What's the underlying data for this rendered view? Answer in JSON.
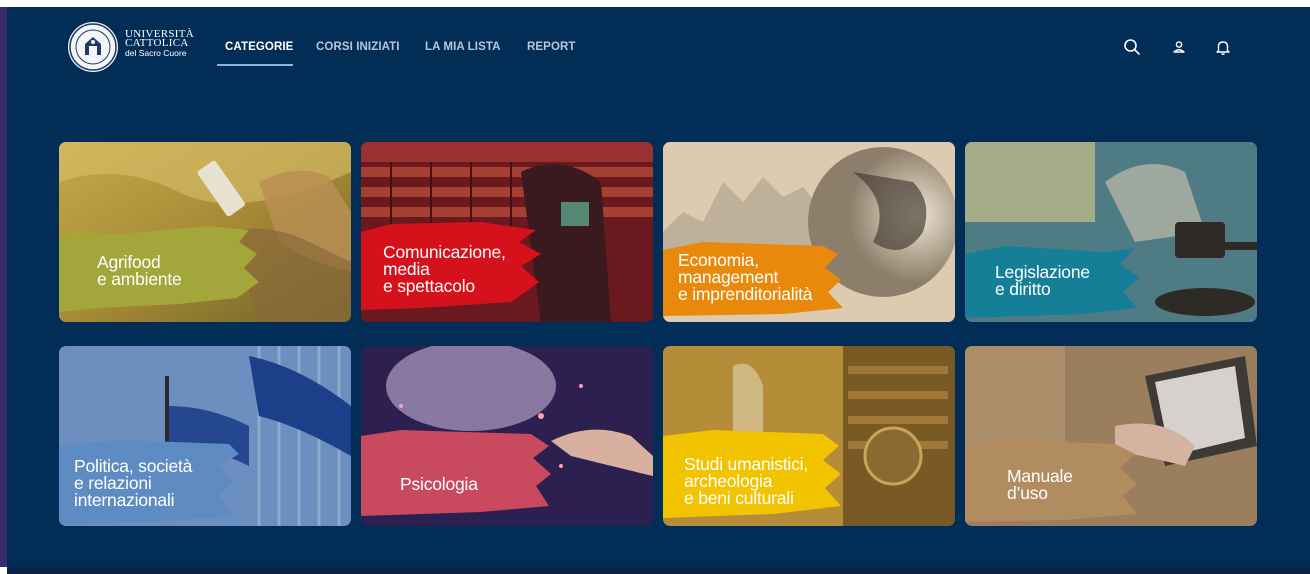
{
  "brand": {
    "line1": "UNIVERSITÀ",
    "line2": "CATTOLICA",
    "line3": "del Sacro Cuore"
  },
  "nav": [
    {
      "label": "CATEGORIE",
      "active": true
    },
    {
      "label": "CORSI INIZIATI",
      "active": false
    },
    {
      "label": "LA MIA LISTA",
      "active": false
    },
    {
      "label": "REPORT",
      "active": false
    }
  ],
  "header_icons": [
    "search-icon",
    "user-icon",
    "bell-icon"
  ],
  "colors": {
    "background": "#022d57",
    "agrifood": "#a3a63a",
    "comunicazione": "#d5111b",
    "economia": "#e8890c",
    "legislazione": "#157f98",
    "politica": "#5f8bc3",
    "psicologia": "#c94a5f",
    "studi": "#f2c300",
    "manuale": "#b08c60"
  },
  "categories": [
    {
      "lines": [
        "Agrifood",
        "e ambiente"
      ]
    },
    {
      "lines": [
        "Comunicazione,",
        "media",
        "e spettacolo"
      ]
    },
    {
      "lines": [
        "Economia,",
        "management",
        "e imprenditorialità"
      ]
    },
    {
      "lines": [
        "Legislazione",
        "e diritto"
      ]
    },
    {
      "lines": [
        "Politica, società",
        "e relazioni",
        "internazionali"
      ]
    },
    {
      "lines": [
        "Psicologia"
      ]
    },
    {
      "lines": [
        "Studi umanistici,",
        "archeologia",
        "e beni culturali"
      ]
    },
    {
      "lines": [
        "Manuale",
        "d’uso"
      ]
    }
  ]
}
